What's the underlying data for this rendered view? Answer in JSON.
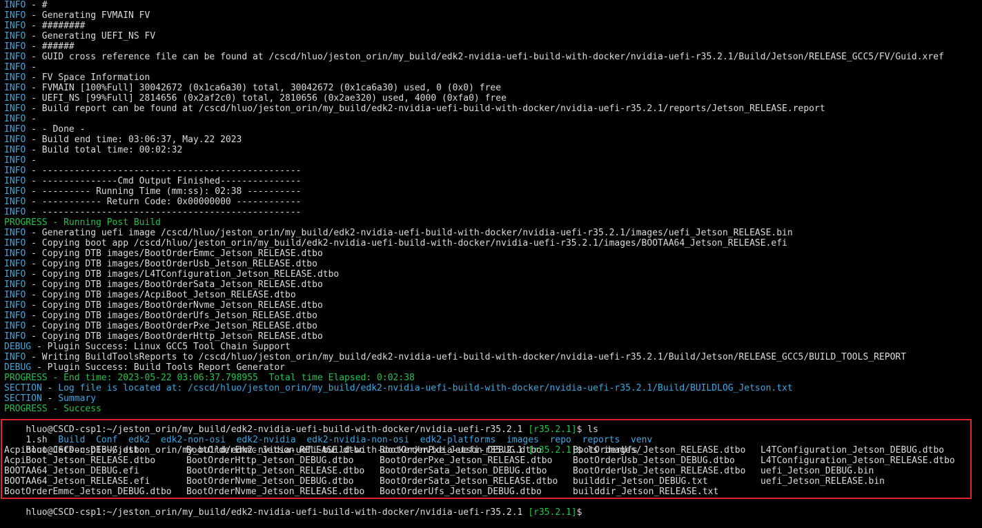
{
  "log_lines": [
    {
      "tag": "INFO",
      "type": "info",
      "text": "#"
    },
    {
      "tag": "INFO",
      "type": "info",
      "text": "Generating FVMAIN FV"
    },
    {
      "tag": "INFO",
      "type": "info",
      "text": "########"
    },
    {
      "tag": "INFO",
      "type": "info",
      "text": "Generating UEFI_NS FV"
    },
    {
      "tag": "INFO",
      "type": "info",
      "text": "######"
    },
    {
      "tag": "INFO",
      "type": "info",
      "text": "GUID cross reference file can be found at /cscd/hluo/jeston_orin/my_build/edk2-nvidia-uefi-build-with-docker/nvidia-uefi-r35.2.1/Build/Jetson/RELEASE_GCC5/FV/Guid.xref"
    },
    {
      "tag": "INFO",
      "type": "info",
      "text": ""
    },
    {
      "tag": "INFO",
      "type": "info",
      "text": "FV Space Information"
    },
    {
      "tag": "INFO",
      "type": "info",
      "text": "FVMAIN [100%Full] 30042672 (0x1ca6a30) total, 30042672 (0x1ca6a30) used, 0 (0x0) free"
    },
    {
      "tag": "INFO",
      "type": "info",
      "text": "UEFI_NS [99%Full] 2814656 (0x2af2c0) total, 2810656 (0x2ae320) used, 4000 (0xfa0) free"
    },
    {
      "tag": "INFO",
      "type": "info",
      "text": "Build report can be found at /cscd/hluo/jeston_orin/my_build/edk2-nvidia-uefi-build-with-docker/nvidia-uefi-r35.2.1/reports/Jetson_RELEASE.report"
    },
    {
      "tag": "INFO",
      "type": "info",
      "text": ""
    },
    {
      "tag": "INFO",
      "type": "info",
      "text": "- Done -"
    },
    {
      "tag": "INFO",
      "type": "info",
      "text": "Build end time: 03:06:37, May.22 2023"
    },
    {
      "tag": "INFO",
      "type": "info",
      "text": "Build total time: 00:02:32"
    },
    {
      "tag": "INFO",
      "type": "info",
      "text": ""
    },
    {
      "tag": "INFO",
      "type": "info",
      "text": "------------------------------------------------"
    },
    {
      "tag": "INFO",
      "type": "info",
      "text": "--------------Cmd Output Finished---------------"
    },
    {
      "tag": "INFO",
      "type": "info",
      "text": "--------- Running Time (mm:ss): 02:38 ----------"
    },
    {
      "tag": "INFO",
      "type": "info",
      "text": "----------- Return Code: 0x00000000 ------------"
    },
    {
      "tag": "INFO",
      "type": "info",
      "text": "------------------------------------------------"
    },
    {
      "tag": "PROGRESS",
      "type": "progress",
      "text": "Running Post Build"
    },
    {
      "tag": "INFO",
      "type": "info",
      "text": "Generating uefi image /cscd/hluo/jeston_orin/my_build/edk2-nvidia-uefi-build-with-docker/nvidia-uefi-r35.2.1/images/uefi_Jetson_RELEASE.bin"
    },
    {
      "tag": "INFO",
      "type": "info",
      "text": "Copying boot app /cscd/hluo/jeston_orin/my_build/edk2-nvidia-uefi-build-with-docker/nvidia-uefi-r35.2.1/images/BOOTAA64_Jetson_RELEASE.efi"
    },
    {
      "tag": "INFO",
      "type": "info",
      "text": "Copying DTB images/BootOrderEmmc_Jetson_RELEASE.dtbo"
    },
    {
      "tag": "INFO",
      "type": "info",
      "text": "Copying DTB images/BootOrderUsb_Jetson_RELEASE.dtbo"
    },
    {
      "tag": "INFO",
      "type": "info",
      "text": "Copying DTB images/L4TConfiguration_Jetson_RELEASE.dtbo"
    },
    {
      "tag": "INFO",
      "type": "info",
      "text": "Copying DTB images/BootOrderSata_Jetson_RELEASE.dtbo"
    },
    {
      "tag": "INFO",
      "type": "info",
      "text": "Copying DTB images/AcpiBoot_Jetson_RELEASE.dtbo"
    },
    {
      "tag": "INFO",
      "type": "info",
      "text": "Copying DTB images/BootOrderNvme_Jetson_RELEASE.dtbo"
    },
    {
      "tag": "INFO",
      "type": "info",
      "text": "Copying DTB images/BootOrderUfs_Jetson_RELEASE.dtbo"
    },
    {
      "tag": "INFO",
      "type": "info",
      "text": "Copying DTB images/BootOrderPxe_Jetson_RELEASE.dtbo"
    },
    {
      "tag": "INFO",
      "type": "info",
      "text": "Copying DTB images/BootOrderHttp_Jetson_RELEASE.dtbo"
    },
    {
      "tag": "DEBUG",
      "type": "debug",
      "text": "Plugin Success: Linux GCC5 Tool Chain Support"
    },
    {
      "tag": "INFO",
      "type": "info",
      "text": "Writing BuildToolsReports to /cscd/hluo/jeston_orin/my_build/edk2-nvidia-uefi-build-with-docker/nvidia-uefi-r35.2.1/Build/Jetson/RELEASE_GCC5/BUILD_TOOLS_REPORT"
    },
    {
      "tag": "DEBUG",
      "type": "debug",
      "text": "Plugin Success: Build Tools Report Generator"
    },
    {
      "tag": "PROGRESS",
      "type": "progress",
      "text": "End time: 2023-05-22 03:06:37.798955  Total time Elapsed: 0:02:38"
    },
    {
      "tag": "SECTION",
      "type": "section",
      "text": "Log file is located at: /cscd/hluo/jeston_orin/my_build/edk2-nvidia-uefi-build-with-docker/nvidia-uefi-r35.2.1/Build/BUILDLOG_Jetson.txt"
    },
    {
      "tag": "SECTION",
      "type": "section",
      "text": "Summary"
    },
    {
      "tag": "PROGRESS",
      "type": "progress",
      "text": "Success"
    }
  ],
  "prompt1": {
    "user_host": "hluo@CSCD-csp1:",
    "path": "~/jeston_orin/my_build/edk2-nvidia-uefi-build-with-docker/nvidia-uefi-r35.2.1",
    "branch": "[r35.2.1]",
    "cmd": "$ ls"
  },
  "ls_root": {
    "file": "1.sh",
    "dirs": [
      "Build",
      "Conf",
      "edk2",
      "edk2-non-osi",
      "edk2-nvidia",
      "edk2-nvidia-non-osi",
      "edk2-platforms",
      "images",
      "repo",
      "reports",
      "venv"
    ]
  },
  "prompt2": {
    "user_host": "hluo@CSCD-csp1:",
    "path": "~/jeston_orin/my_build/edk2-nvidia-uefi-build-with-docker/nvidia-uefi-r35.2.1",
    "branch": "[r35.2.1]",
    "cmd": "$ ls images/"
  },
  "ls_images_rows": [
    [
      "AcpiBoot_Jetson_DEBUG.dtbo",
      "BootOrderEmmc_Jetson_RELEASE.dtbo",
      "BootOrderPxe_Jetson_DEBUG.dtbo",
      "BootOrderUfs_Jetson_RELEASE.dtbo",
      "L4TConfiguration_Jetson_DEBUG.dtbo"
    ],
    [
      "AcpiBoot_Jetson_RELEASE.dtbo",
      "BootOrderHttp_Jetson_DEBUG.dtbo",
      "BootOrderPxe_Jetson_RELEASE.dtbo",
      "BootOrderUsb_Jetson_DEBUG.dtbo",
      "L4TConfiguration_Jetson_RELEASE.dtbo"
    ],
    [
      "BOOTAA64_Jetson_DEBUG.efi",
      "BootOrderHttp_Jetson_RELEASE.dtbo",
      "BootOrderSata_Jetson_DEBUG.dtbo",
      "BootOrderUsb_Jetson_RELEASE.dtbo",
      "uefi_Jetson_DEBUG.bin"
    ],
    [
      "BOOTAA64_Jetson_RELEASE.efi",
      "BootOrderNvme_Jetson_DEBUG.dtbo",
      "BootOrderSata_Jetson_RELEASE.dtbo",
      "builddir_Jetson_DEBUG.txt",
      "uefi_Jetson_RELEASE.bin"
    ],
    [
      "BootOrderEmmc_Jetson_DEBUG.dtbo",
      "BootOrderNvme_Jetson_RELEASE.dtbo",
      "BootOrderUfs_Jetson_DEBUG.dtbo",
      "builddir_Jetson_RELEASE.txt",
      ""
    ]
  ],
  "prompt3": {
    "user_host": "hluo@CSCD-csp1:",
    "path": "~/jeston_orin/my_build/edk2-nvidia-uefi-build-with-docker/nvidia-uefi-r35.2.1",
    "branch": "[r35.2.1]",
    "cmd": "$"
  },
  "colors": {
    "background": "#000000",
    "text": "#dcdcdc",
    "info_tag": "#3fa8e0",
    "progress_tag": "#23c24c",
    "directory": "#3fa8e0",
    "branch": "#23c24c",
    "highlight_border": "#e0262d"
  }
}
